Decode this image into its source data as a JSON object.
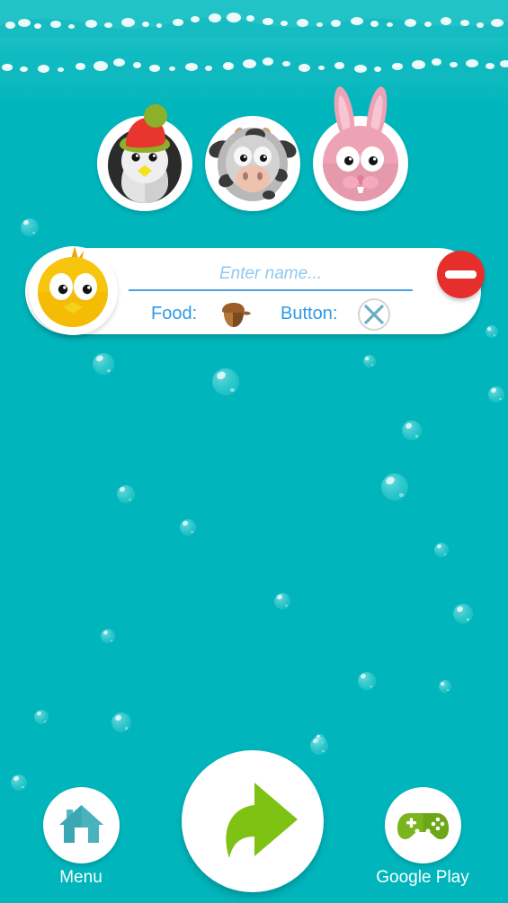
{
  "app": {
    "background_color": "#00b5bc",
    "theme": "underwater-teal"
  },
  "avatars": {
    "items": [
      {
        "name": "penguin",
        "label": "Penguin",
        "colors": {
          "hat_top": "#e8352e",
          "hat_band": "#8cb02a",
          "pom": "#8cb02a",
          "body": "#d9d9d9",
          "head": "#2b2b2b",
          "beak": "#f5e21a"
        }
      },
      {
        "name": "cow",
        "label": "Cow",
        "colors": {
          "face": "#b8b8b8",
          "spots": "#3a3a3a",
          "horn": "#c8a06a",
          "snout": "#eec3ae"
        }
      },
      {
        "name": "bunny",
        "label": "Bunny",
        "colors": {
          "face": "#eda3b5",
          "ear_inner": "#f5c3ce",
          "nose": "#f08fa6",
          "tooth": "#ffffff"
        }
      }
    ]
  },
  "entry_card": {
    "avatar": {
      "name": "chick",
      "label": "Chick",
      "colors": {
        "body": "#f7c40e",
        "beak": "#f2d21c",
        "tuft": "#e8a90d"
      }
    },
    "name_input": {
      "placeholder": "Enter name...",
      "value": "",
      "underline_color": "#4aa3e8"
    },
    "food": {
      "label": "Food:",
      "icon": "acorn-icon"
    },
    "button": {
      "label": "Button:",
      "icon": "close-x-icon"
    },
    "remove": {
      "icon": "minus-circle-icon",
      "color": "#e62f2c"
    },
    "label_color": "#2f9ae8"
  },
  "bottom_bar": {
    "menu": {
      "label": "Menu",
      "icon": "home-icon",
      "icon_color": "#3aa7b3"
    },
    "next": {
      "icon": "forward-arrow-icon",
      "icon_color": "#7ec214"
    },
    "google_play": {
      "label": "Google Play",
      "icon": "gamepad-icon",
      "icon_color": "#7ab51d"
    }
  }
}
